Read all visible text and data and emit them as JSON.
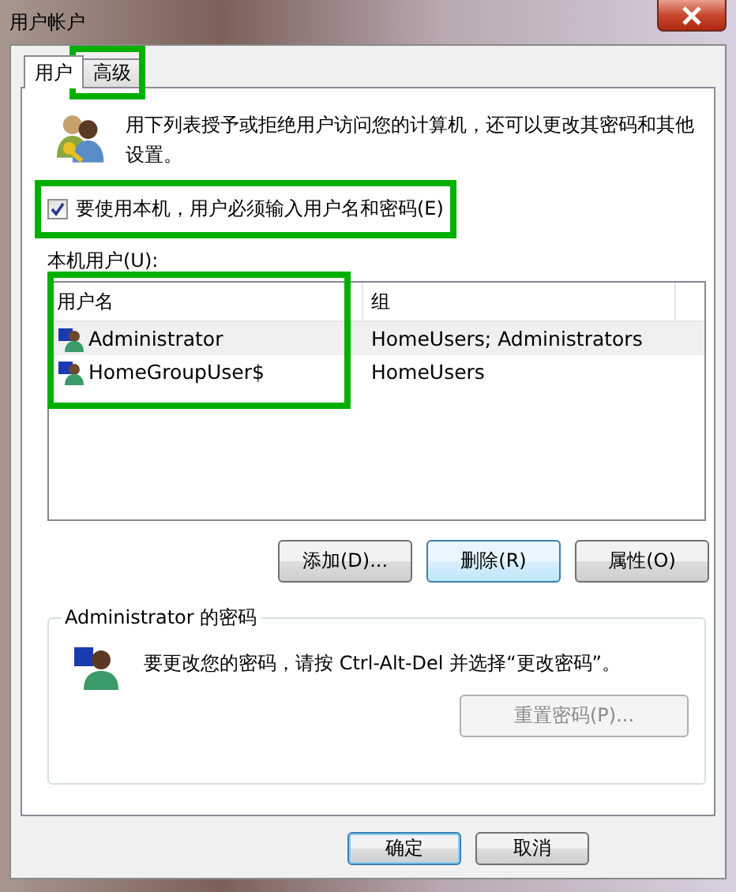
{
  "window": {
    "title": "用户帐户"
  },
  "tabs": [
    {
      "label": "用户",
      "selected": true
    },
    {
      "label": "高级",
      "selected": false
    }
  ],
  "description": "用下列表授予或拒绝用户访问您的计算机，还可以更改其密码和其他设置。",
  "login_checkbox": {
    "label": "要使用本机，用户必须输入用户名和密码(E)",
    "checked": true
  },
  "users_label": "本机用户(U):",
  "table": {
    "columns": [
      "用户名",
      "组"
    ],
    "rows": [
      {
        "name": "Administrator",
        "group": "HomeUsers; Administrators",
        "selected": true
      },
      {
        "name": "HomeGroupUser$",
        "group": "HomeUsers",
        "selected": false
      }
    ]
  },
  "user_buttons": [
    {
      "label": "添加(D)...",
      "focused": false
    },
    {
      "label": "删除(R)",
      "focused": true
    },
    {
      "label": "属性(O)",
      "focused": false
    }
  ],
  "password_group": {
    "title": "Administrator 的密码",
    "text": "要更改您的密码，请按 Ctrl-Alt-Del 并选择“更改密码”。",
    "reset_button": {
      "label": "重置密码(P)...",
      "disabled": true
    }
  },
  "dialog_buttons": [
    {
      "label": "确定",
      "default": true
    },
    {
      "label": "取消",
      "default": false
    }
  ],
  "annotations": [
    {
      "kind": "highlight"
    },
    {
      "kind": "highlight"
    },
    {
      "kind": "highlight"
    }
  ]
}
